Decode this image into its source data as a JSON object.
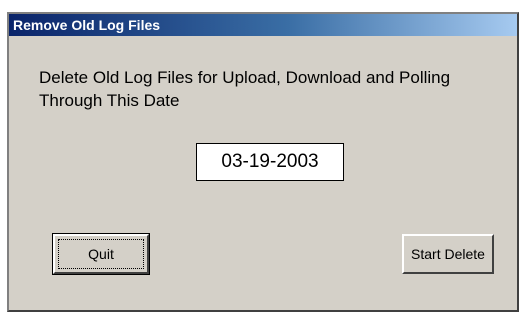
{
  "window": {
    "title": "Remove Old Log Files"
  },
  "main": {
    "prompt": "Delete Old Log Files for Upload, Download and Polling Through This Date",
    "date_value": "03-19-2003"
  },
  "buttons": {
    "quit_label": "Quit",
    "start_delete_label": "Start Delete"
  },
  "colors": {
    "title_bar_start": "#0a246a",
    "title_bar_end": "#a6caf0",
    "dialog_face": "#d4d0c8"
  }
}
